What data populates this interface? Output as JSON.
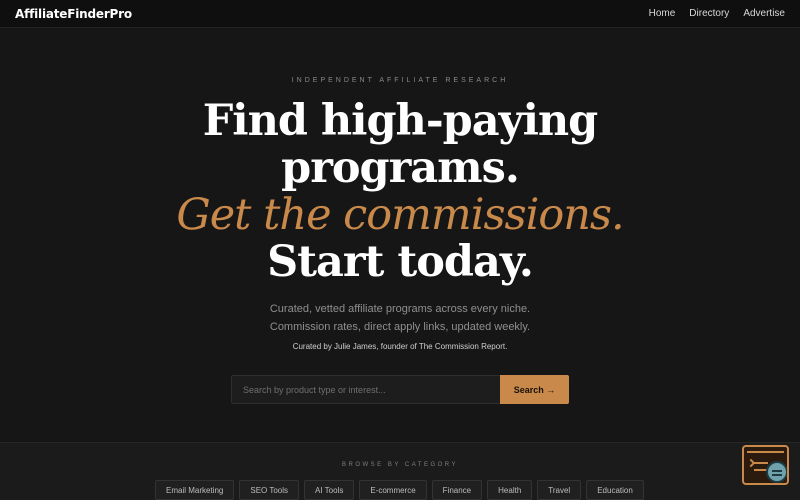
{
  "header": {
    "brand": "AffiliateFinderPro",
    "nav": [
      {
        "label": "Home"
      },
      {
        "label": "Directory"
      },
      {
        "label": "Advertise"
      }
    ]
  },
  "hero": {
    "eyebrow": "INDEPENDENT AFFILIATE RESEARCH",
    "headline_line1": "Find high-paying",
    "headline_line2": "programs.",
    "headline_accent": "Get the commissions.",
    "headline_line4": "Start today.",
    "sub_line1": "Curated, vetted affiliate programs across every niche.",
    "sub_line2": "Commission rates, direct apply links, updated weekly.",
    "curated_by": "Curated by Julie James, founder of The Commission Report."
  },
  "search": {
    "placeholder": "Search by product type or interest...",
    "button_label": "Search →"
  },
  "browse": {
    "title": "BROWSE BY CATEGORY",
    "categories": [
      {
        "label": "Email Marketing"
      },
      {
        "label": "SEO Tools"
      },
      {
        "label": "AI Tools"
      },
      {
        "label": "E-commerce"
      },
      {
        "label": "Finance"
      },
      {
        "label": "Health"
      },
      {
        "label": "Travel"
      },
      {
        "label": "Education"
      }
    ]
  },
  "theme": {
    "accent": "#c8894a",
    "background": "#141414"
  },
  "icons": {
    "widget": "chat-widget-icon"
  }
}
